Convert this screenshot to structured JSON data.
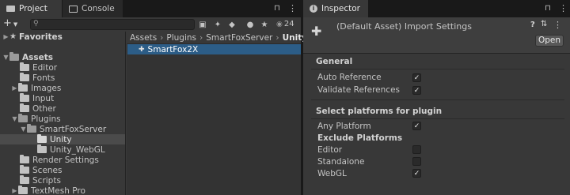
{
  "project": {
    "tabs": [
      {
        "label": "Project",
        "icon": "folder-icon"
      },
      {
        "label": "Console",
        "icon": "console-icon"
      }
    ],
    "toolbar": {
      "add_label": "+",
      "search_placeholder": "",
      "hidden_count": "24"
    },
    "tree": {
      "favorites": "Favorites",
      "assets": "Assets",
      "items": [
        "Editor",
        "Fonts",
        "Images",
        "Input",
        "Other",
        "Plugins"
      ],
      "smartfox": "SmartFoxServer",
      "smartfox_children": [
        "Unity",
        "Unity_WebGL"
      ],
      "more_items": [
        "Render Settings",
        "Scenes",
        "Scripts",
        "TextMesh Pro"
      ]
    },
    "breadcrumb": [
      "Assets",
      "Plugins",
      "SmartFoxServer",
      "Unity"
    ],
    "files": [
      "SmartFox2X"
    ]
  },
  "inspector": {
    "tab_label": "Inspector",
    "title": "(Default Asset) Import Settings",
    "open_label": "Open",
    "general": {
      "title": "General",
      "fields": [
        {
          "label": "Auto Reference",
          "checked": true
        },
        {
          "label": "Validate References",
          "checked": true
        }
      ]
    },
    "platforms": {
      "title": "Select platforms for plugin",
      "any_platform": {
        "label": "Any Platform",
        "checked": true
      },
      "exclude_title": "Exclude Platforms",
      "exclude": [
        {
          "label": "Editor",
          "checked": false
        },
        {
          "label": "Standalone",
          "checked": false
        },
        {
          "label": "WebGL",
          "checked": true
        }
      ]
    }
  }
}
